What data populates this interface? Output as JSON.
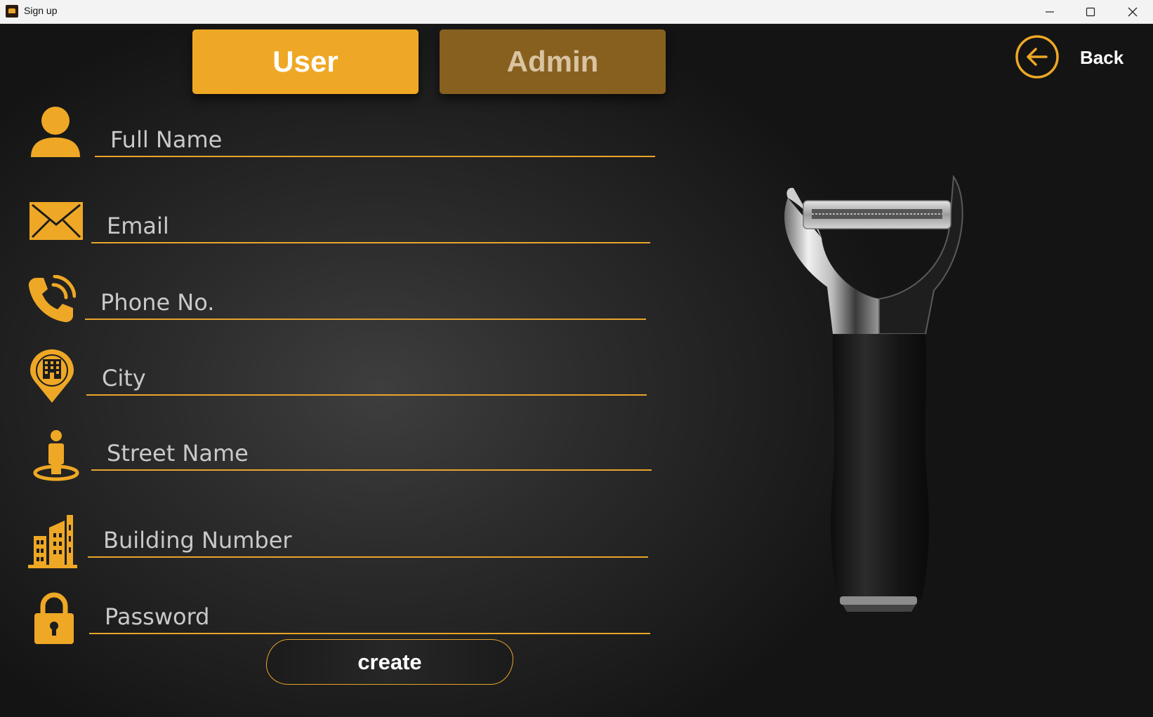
{
  "window": {
    "title": "Sign up",
    "controls": [
      "minimize-icon",
      "maximize-icon",
      "close-icon"
    ]
  },
  "tabs": [
    {
      "label": "User",
      "active": true
    },
    {
      "label": "Admin",
      "active": false
    }
  ],
  "back": {
    "label": "Back",
    "icon": "arrow-left-circle-icon"
  },
  "fields": [
    {
      "icon": "user-icon",
      "placeholder": "Full Name",
      "value": ""
    },
    {
      "icon": "envelope-icon",
      "placeholder": "Email",
      "value": ""
    },
    {
      "icon": "phone-icon",
      "placeholder": "Phone No.",
      "value": ""
    },
    {
      "icon": "city-pin-icon",
      "placeholder": "City",
      "value": ""
    },
    {
      "icon": "street-person-icon",
      "placeholder": "Street Name",
      "value": ""
    },
    {
      "icon": "building-icon",
      "placeholder": "Building Number",
      "value": ""
    },
    {
      "icon": "lock-icon",
      "placeholder": "Password",
      "value": ""
    }
  ],
  "create_button": {
    "label": "create"
  },
  "image": {
    "icon": "peeler-product-image"
  },
  "colors": {
    "accent": "#eea825",
    "admin_tab": "#87601f",
    "background": "#1a1a1a",
    "text": "#ffffff"
  }
}
